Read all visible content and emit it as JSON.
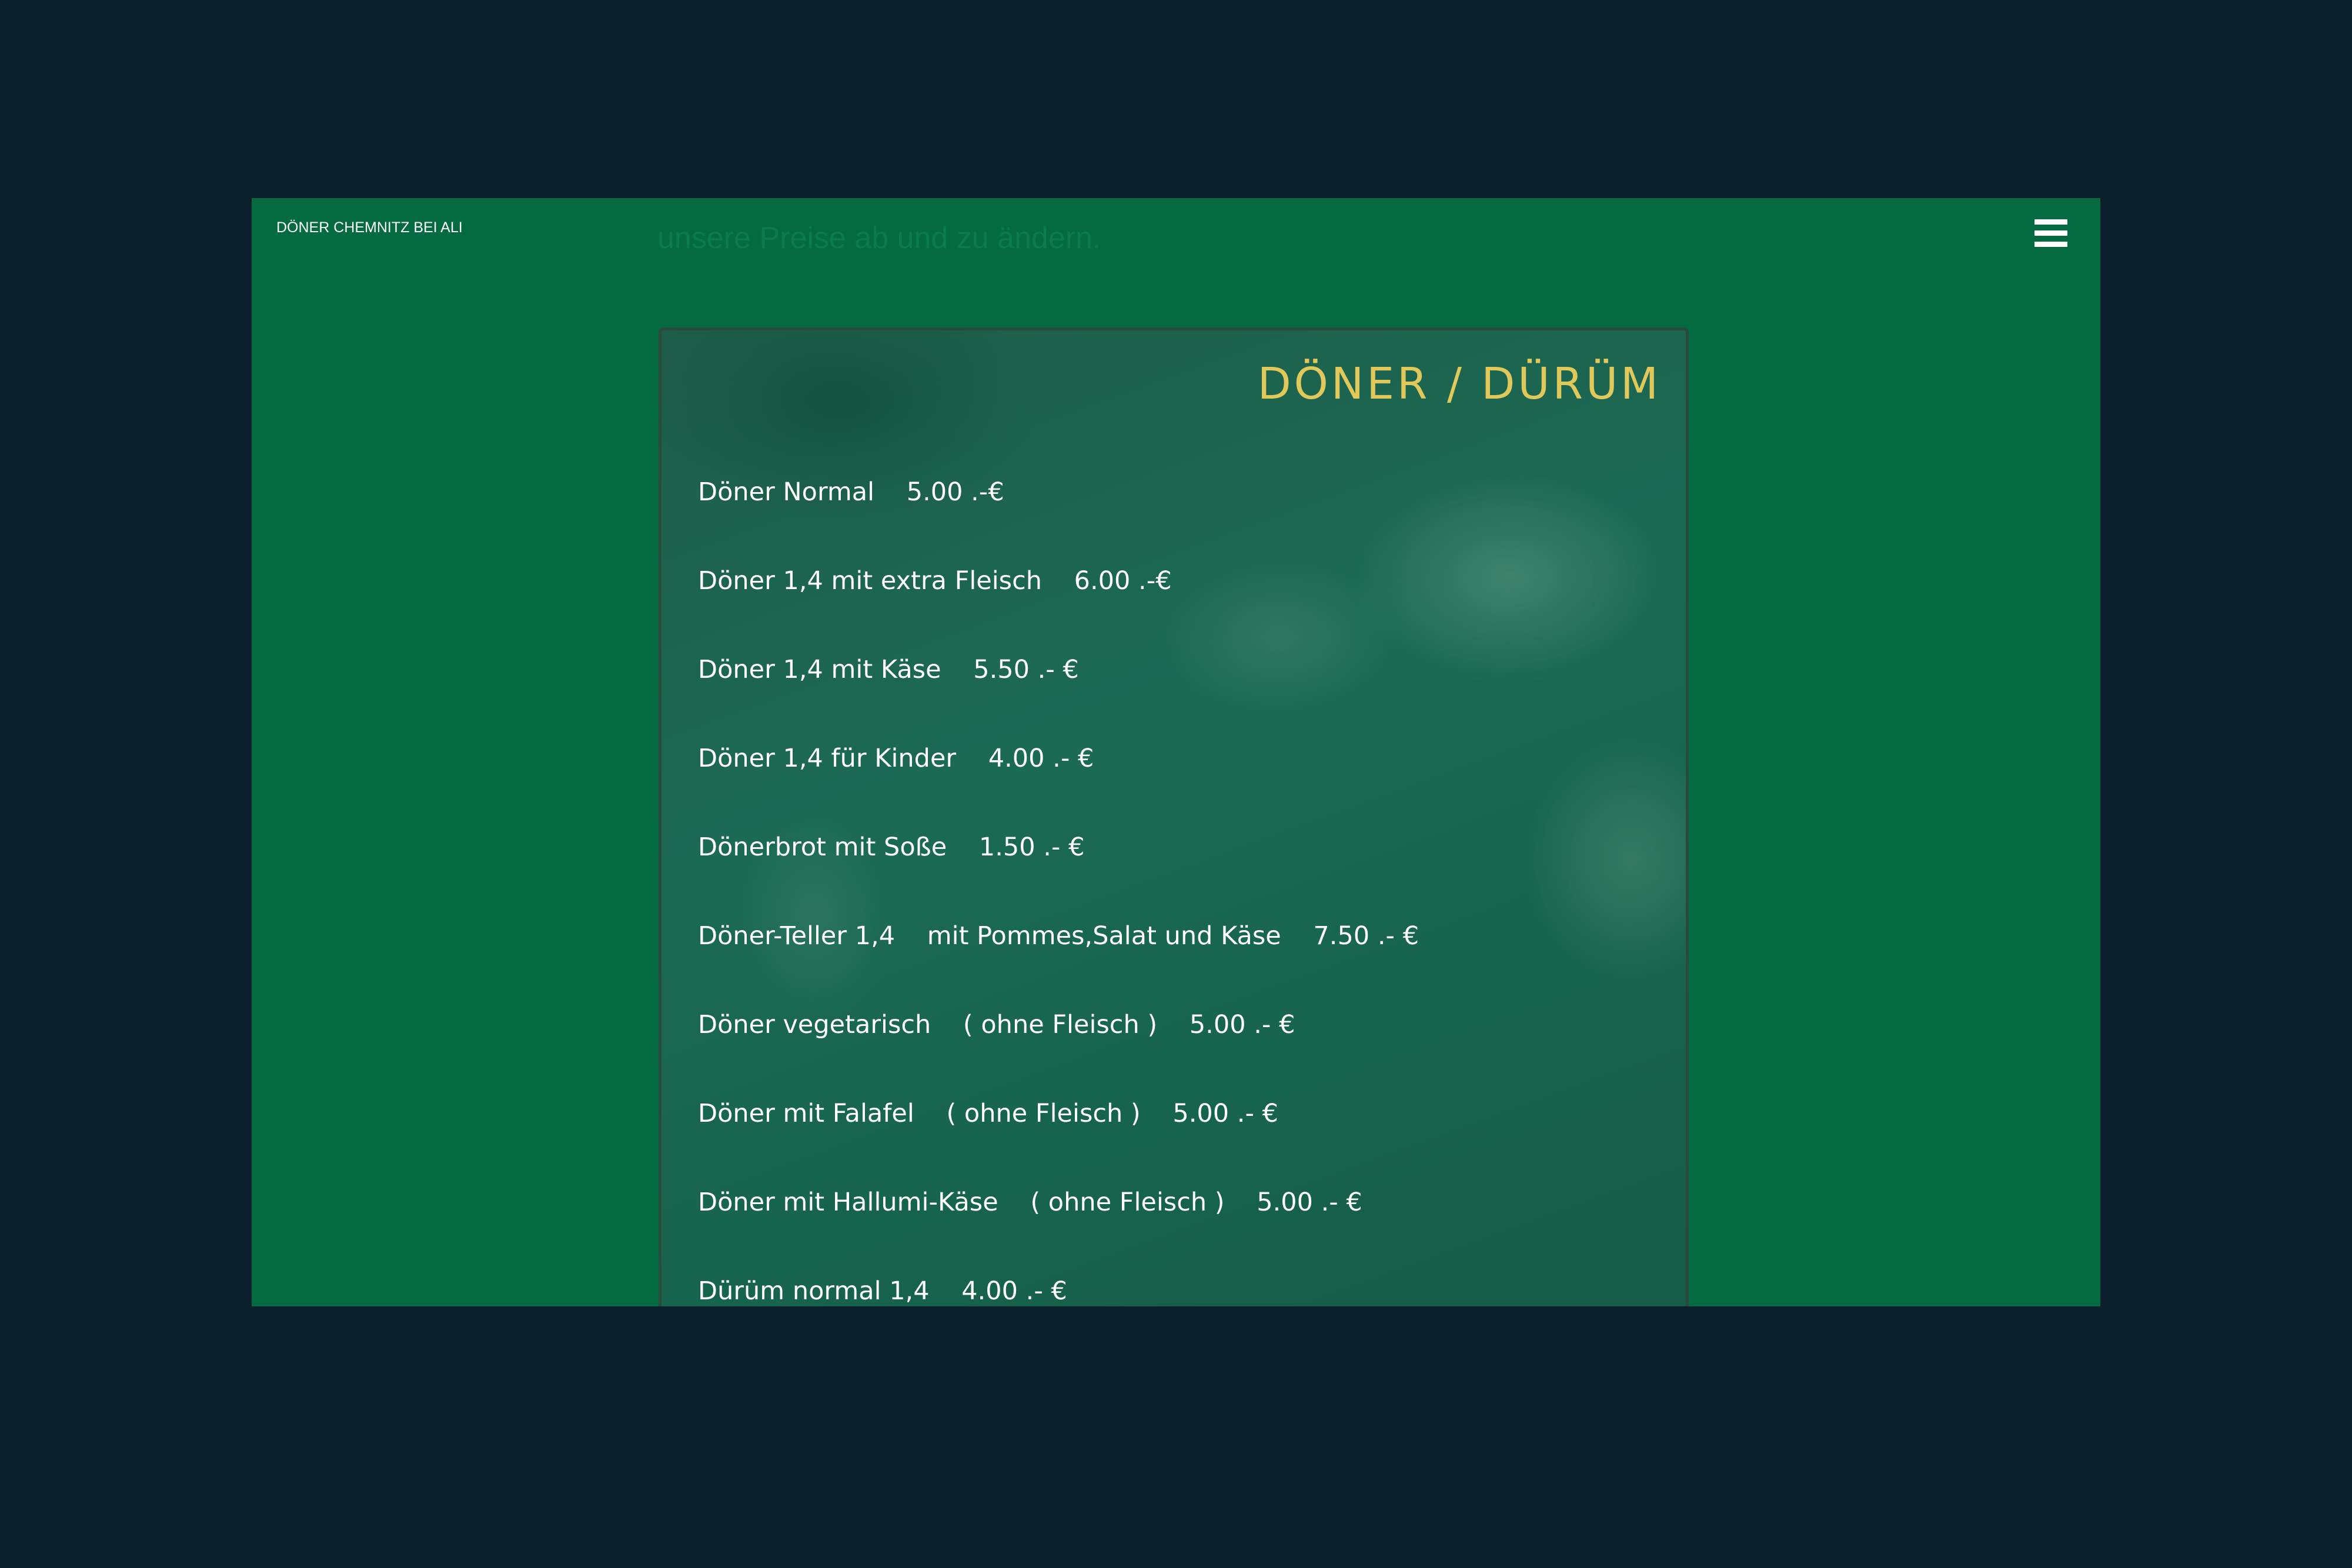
{
  "header": {
    "brand": "DÖNER CHEMNITZ BEI ALI",
    "ghost_text": "unsere Preise ab und zu ändern.",
    "menu_icon": "hamburger-menu-icon"
  },
  "board": {
    "title": "DÖNER  /  DÜRÜM",
    "items": [
      "Döner Normal    5.00 .-€",
      "Döner 1,4 mit extra Fleisch    6.00 .-€",
      "Döner 1,4 mit Käse    5.50 .- €",
      "Döner 1,4 für Kinder    4.00 .- €",
      "Dönerbrot mit Soße    1.50 .- €",
      "Döner-Teller 1,4    mit Pommes,Salat und Käse    7.50 .- €",
      "Döner vegetarisch    ( ohne Fleisch )    5.00 .- €",
      "Döner mit Falafel    ( ohne Fleisch )    5.00 .- €",
      "Döner mit Hallumi-Käse    ( ohne Fleisch )    5.00 .- €",
      "Dürüm normal 1,4    4.00 .- €"
    ]
  },
  "colors": {
    "page_background": "#0a1f2c",
    "window_green": "#036a42",
    "title_gold": "#e0c85a",
    "item_text": "#ffffff"
  }
}
